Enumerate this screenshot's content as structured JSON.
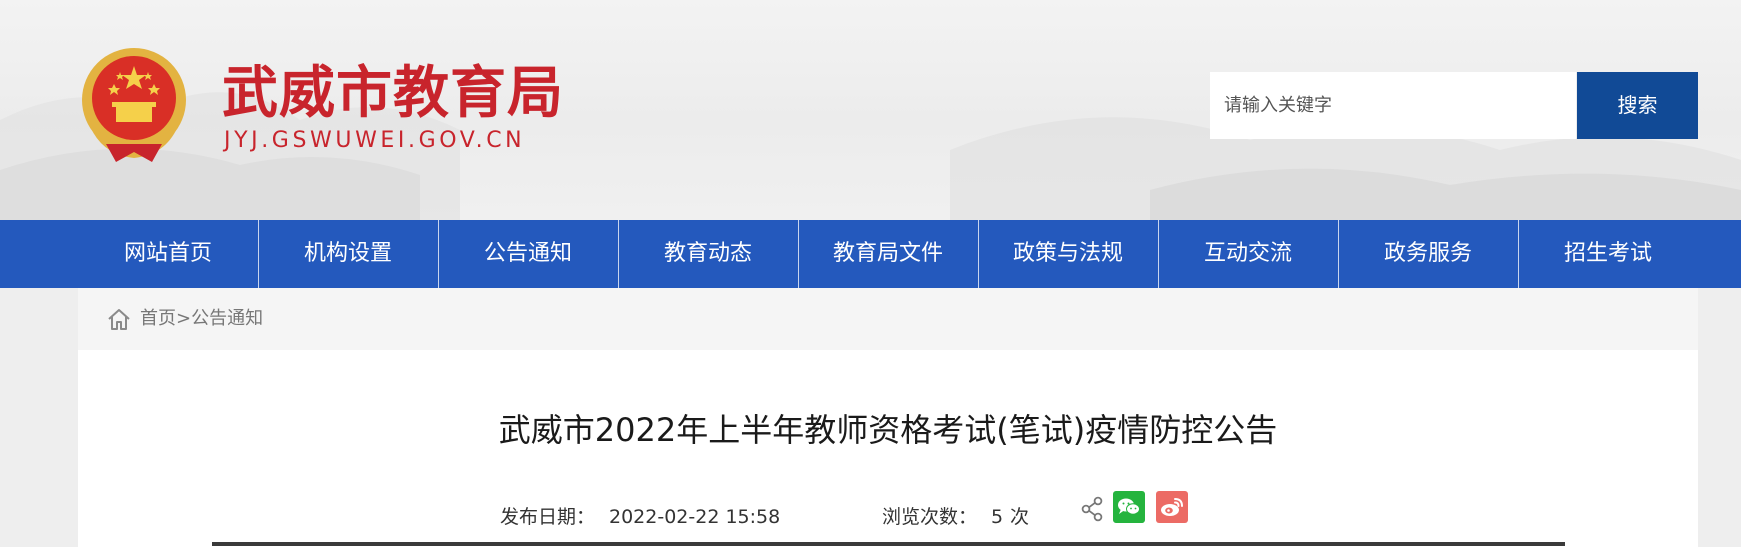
{
  "header": {
    "site_name": "武威市教育局",
    "site_domain": "JYJ.GSWUWEI.GOV.CN",
    "brand_color": "#c8242c",
    "emblem_icon": "national-emblem-icon"
  },
  "search": {
    "placeholder": "请输入关键字",
    "button_label": "搜索",
    "button_color": "#114a96"
  },
  "nav": {
    "color": "#2459bd",
    "items": [
      {
        "label": "网站首页"
      },
      {
        "label": "机构设置"
      },
      {
        "label": "公告通知"
      },
      {
        "label": "教育动态"
      },
      {
        "label": "教育局文件"
      },
      {
        "label": "政策与法规"
      },
      {
        "label": "互动交流"
      },
      {
        "label": "政务服务"
      },
      {
        "label": "招生考试"
      }
    ]
  },
  "breadcrumb": {
    "home_icon": "home-icon",
    "home": "首页",
    "separator": ">",
    "current": "公告通知"
  },
  "article": {
    "title": "武威市2022年上半年教师资格考试(笔试)疫情防控公告",
    "date_label": "发布日期：",
    "date": "2022-02-22 15:58",
    "views_label": "浏览次数：",
    "views": "5",
    "views_unit": "次",
    "share_icons": [
      "share-icon",
      "wechat-icon",
      "weibo-icon"
    ]
  }
}
